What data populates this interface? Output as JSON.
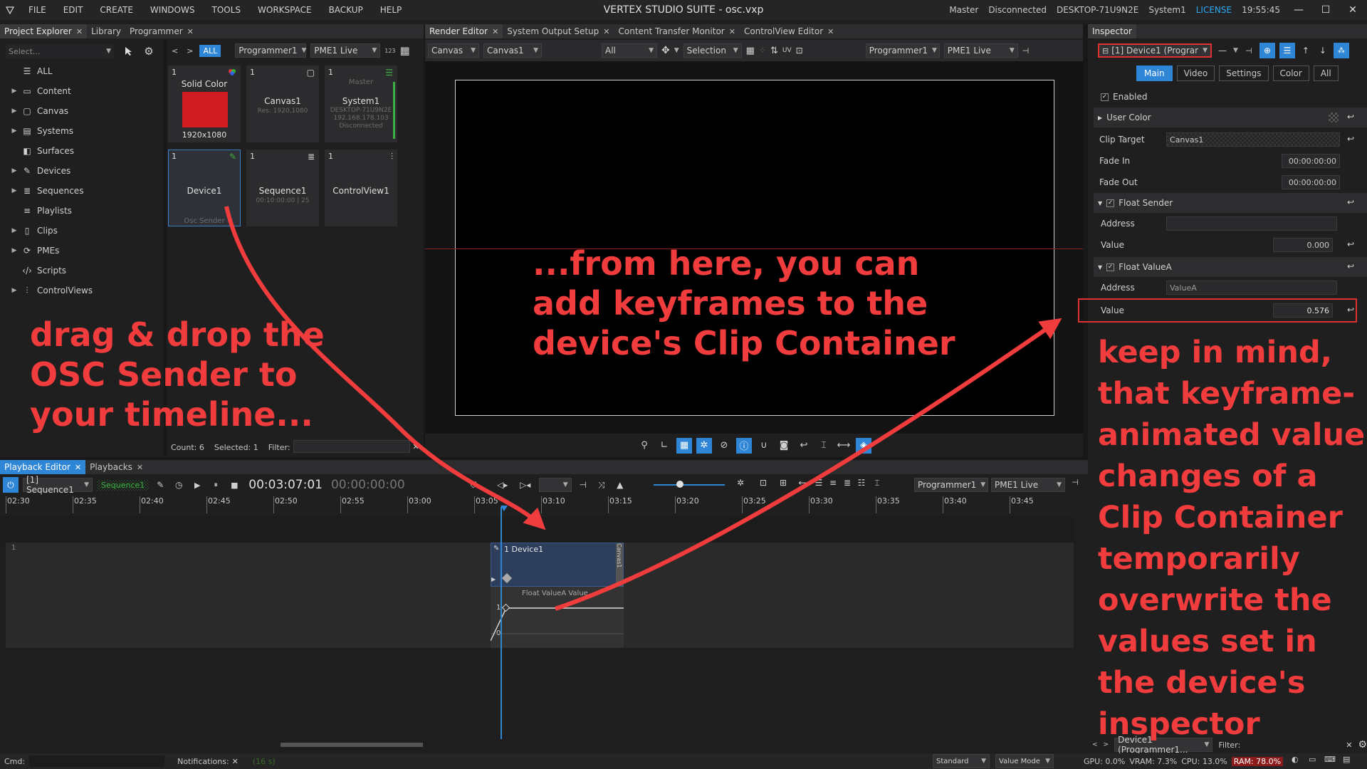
{
  "app": {
    "menu": [
      "FILE",
      "EDIT",
      "CREATE",
      "WINDOWS",
      "TOOLS",
      "WORKSPACE",
      "BACKUP",
      "HELP"
    ],
    "title": "VERTEX STUDIO SUITE - osc.vxp",
    "status": {
      "role": "Master",
      "connection": "Disconnected",
      "machine": "DESKTOP-71U9N2E",
      "system": "System1",
      "license": "LICENSE",
      "time": "19:55:45"
    }
  },
  "left_tabs": [
    "Project Explorer",
    "Library",
    "Programmer"
  ],
  "explorer": {
    "search_placeholder": "Select...",
    "items": [
      "ALL",
      "Content",
      "Canvas",
      "Systems",
      "Surfaces",
      "Devices",
      "Sequences",
      "Playlists",
      "Clips",
      "PMEs",
      "Scripts",
      "ControlViews"
    ]
  },
  "library": {
    "nav_prev": "<",
    "nav_next": ">",
    "filter_all": "ALL",
    "programmer": "Programmer1",
    "pme": "PME1 Live",
    "count_icon": "123",
    "cards": [
      {
        "num": "1",
        "name": "Solid Color",
        "sub": "1920x1080"
      },
      {
        "num": "1",
        "name": "Canvas1",
        "sub": "Res: 1920,1080"
      },
      {
        "num": "1",
        "name": "System1",
        "top": "Master",
        "sub": "DESKTOP-71U9N2E\n192.168.178.103\nDisconnected"
      },
      {
        "num": "1",
        "name": "Device1",
        "sub": "Osc Sender"
      },
      {
        "num": "1",
        "name": "Sequence1",
        "sub": "00:10:00:00 | 25"
      },
      {
        "num": "1",
        "name": "ControlView1",
        "sub": ""
      }
    ],
    "count_label": "Count: 6",
    "selected_label": "Selected: 1",
    "filter_label": "Filter:"
  },
  "center_tabs": [
    "Render Editor",
    "System Output Setup",
    "Content Transfer Monitor",
    "ControlView Editor"
  ],
  "render_toolbar": {
    "canvas": "Canvas",
    "canvas1": "Canvas1",
    "all": "All",
    "selection": "Selection",
    "programmer": "Programmer1",
    "pme": "PME1 Live"
  },
  "inspector": {
    "tab": "Inspector",
    "target": "[1] Device1 (Programmer",
    "buttons": [
      "Main",
      "Video",
      "Settings",
      "Color",
      "All"
    ],
    "enabled": "Enabled",
    "user_color": "User Color",
    "clip_target_label": "Clip Target",
    "clip_target_value": "Canvas1",
    "fade_in_label": "Fade In",
    "fade_in_value": "00:00:00:00",
    "fade_out_label": "Fade Out",
    "fade_out_value": "00:00:00:00",
    "float_sender": "Float Sender",
    "address_label": "Address",
    "value_label": "Value",
    "fs_value": "0.000",
    "float_valuea": "Float ValueA",
    "fva_address": "ValueA",
    "fva_value": "0.576",
    "footer_target": "Device1 (Programmer1...",
    "footer_filter": "Filter:"
  },
  "bottom_tabs": [
    "Playback Editor",
    "Playbacks"
  ],
  "playback": {
    "sequence": "[1] Sequence1",
    "sequence_badge": "Sequence1",
    "timecode": "00:03:07:01",
    "timecode2": "00:00:00:00",
    "programmer": "Programmer1",
    "pme": "PME1 Live",
    "ticks": [
      "02:30",
      "02:35",
      "02:40",
      "02:45",
      "02:50",
      "02:55",
      "03:00",
      "03:05",
      "03:10",
      "03:15",
      "03:20",
      "03:25",
      "03:30",
      "03:35",
      "03:40",
      "03:45"
    ],
    "track_num": "1",
    "clip_title": "1 Device1",
    "clip_side": "Canvas1",
    "keyframe_label": "Float ValueA Value",
    "kf_one": "1",
    "kf_zero": "0"
  },
  "statusbar": {
    "cmd": "Cmd:",
    "notifications": "Notifications:",
    "notif_time": "(16 s)",
    "mode1": "Standard",
    "mode2": "Value Mode",
    "gpu": "GPU: 0.0%",
    "vram": "VRAM: 7.3%",
    "cpu": "CPU: 13.0%",
    "ram": "RAM: 78.0%"
  },
  "annotations": {
    "left": [
      "drag & drop the",
      "OSC Sender to",
      "your timeline..."
    ],
    "center": [
      "...from here, you can",
      "add keyframes to the",
      "device's Clip Container"
    ],
    "right": [
      "keep in mind,",
      "that keyframe-",
      "animated value",
      "changes of a",
      "Clip Container",
      "temporarily",
      "overwrite the",
      "values set in",
      "the device's",
      "inspector"
    ]
  },
  "colors": {
    "accent": "#2f86d6",
    "annotation": "#f03c3c",
    "solid_color": "#d21c24"
  }
}
